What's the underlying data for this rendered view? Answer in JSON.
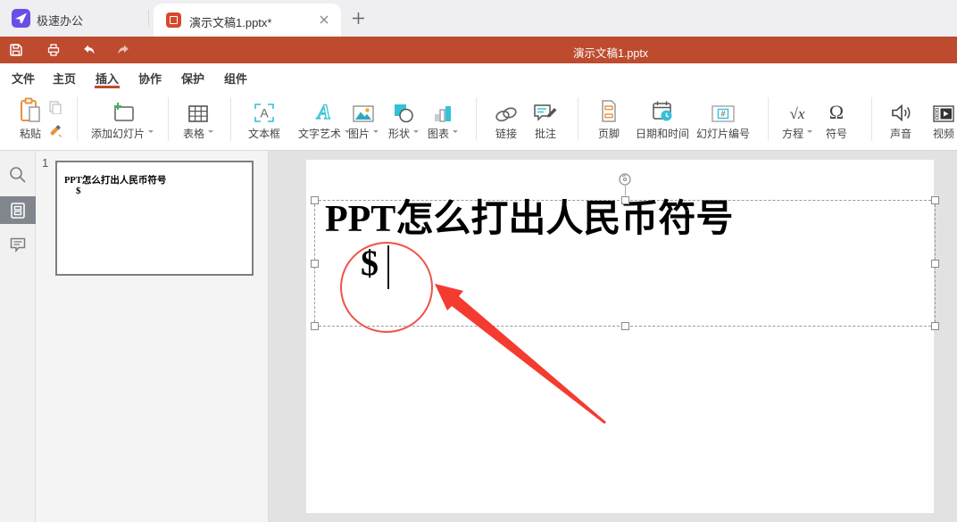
{
  "tabbar": {
    "app_name": "极速办公",
    "tab_title": "演示文稿1.pptx*"
  },
  "titlebar": {
    "document_name": "演示文稿1.pptx"
  },
  "menu": {
    "active": "插入",
    "items": [
      {
        "label": "文件"
      },
      {
        "label": "主页"
      },
      {
        "label": "插入"
      },
      {
        "label": "协作"
      },
      {
        "label": "保护"
      },
      {
        "label": "组件"
      }
    ]
  },
  "ribbon": {
    "items": [
      {
        "label": "粘贴"
      },
      {
        "label": "添加幻灯片",
        "caret": true
      },
      {
        "label": "表格",
        "caret": true
      },
      {
        "label": "文本框"
      },
      {
        "label": "文字艺术",
        "caret": true
      },
      {
        "label": "图片",
        "caret": true
      },
      {
        "label": "形状",
        "caret": true
      },
      {
        "label": "图表",
        "caret": true
      },
      {
        "label": "链接"
      },
      {
        "label": "批注"
      },
      {
        "label": "页脚"
      },
      {
        "label": "日期和时间"
      },
      {
        "label": "幻灯片编号"
      },
      {
        "label": "方程",
        "caret": true
      },
      {
        "label": "符号"
      },
      {
        "label": "声音"
      },
      {
        "label": "视频"
      }
    ],
    "icon_glyphs": {
      "textbox": "A",
      "wordart": "A",
      "equation": "√x",
      "symbol": "Ω",
      "slide_number": "#"
    }
  },
  "slides_panel": {
    "slide_number": "1"
  },
  "slide": {
    "title": "PPT怎么打出人民币符号",
    "typed_symbol": "$"
  },
  "colors": {
    "accent_red": "#BE4B2E",
    "annotation_red": "#F43B30",
    "annotation_circle_red": "#F0524B",
    "icon_teal": "#35C1D8",
    "icon_orange": "#E8923F",
    "app_purple": "#6B4EE6",
    "tab_icon_orange": "#D6492B"
  }
}
